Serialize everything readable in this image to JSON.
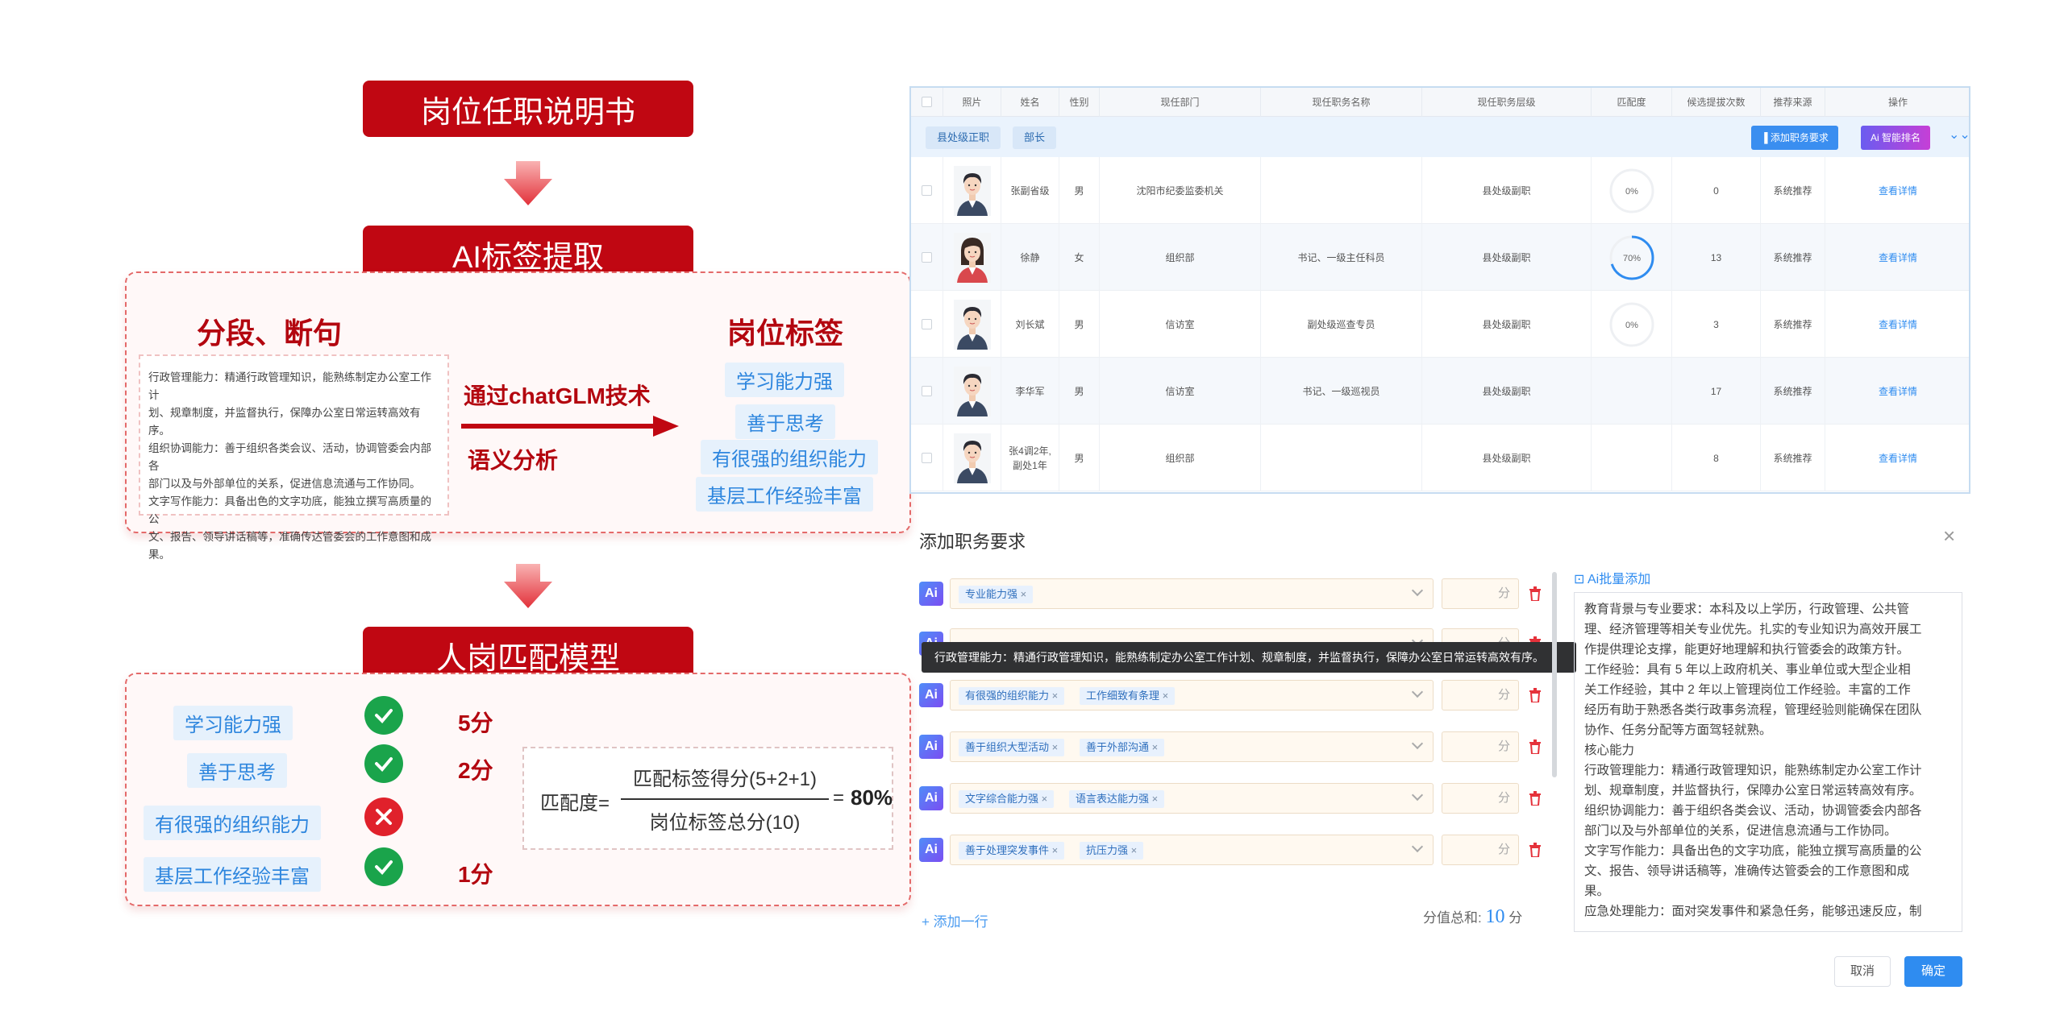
{
  "flow": {
    "title1": "岗位任职说明书",
    "title2": "AI标签提取",
    "title3": "人岗匹配模型",
    "segment_heading": "分段、断句",
    "tag_heading": "岗位标签",
    "via_label": "通过chatGLM技术",
    "semantic_label": "语义分析",
    "text_lines": [
      "行政管理能力：精通行政管理知识，能熟练制定办公室工作计",
      "划、规章制度，并监督执行，保障办公室日常运转高效有序。",
      "组织协调能力：善于组织各类会议、活动，协调管委会内部各",
      "部门以及与外部单位的关系，促进信息流通与工作协同。",
      "文字写作能力：具备出色的文字功底，能独立撰写高质量的公",
      "文、报告、领导讲话稿等，准确传达管委会的工作意图和成",
      "果。"
    ],
    "tags": [
      "学习能力强",
      "善于思考",
      "有很强的组织能力",
      "基层工作经验丰富"
    ],
    "match": [
      {
        "tag": "学习能力强",
        "ok": true,
        "score": "5分"
      },
      {
        "tag": "善于思考",
        "ok": true,
        "score": "2分"
      },
      {
        "tag": "有很强的组织能力",
        "ok": false,
        "score": ""
      },
      {
        "tag": "基层工作经验丰富",
        "ok": true,
        "score": "1分"
      }
    ],
    "formula": {
      "prefix": "匹配度=",
      "numerator": "匹配标签得分(5+2+1)",
      "denominator": "岗位标签总分(10)",
      "equals": "=",
      "result": "80%"
    }
  },
  "table": {
    "headers": [
      "",
      "照片",
      "姓名",
      "性别",
      "现任部门",
      "现任职务名称",
      "现任职务层级",
      "匹配度",
      "候选提拔次数",
      "推荐来源",
      "操作"
    ],
    "filters": [
      "县处级正职",
      "部长"
    ],
    "btn_add": "添加职务要求",
    "btn_ai": "智能排名",
    "ai_prefix": "Ai",
    "rows": [
      {
        "name": "张副省级",
        "gender": "男",
        "dept": "沈阳市纪委监委机关",
        "title": "",
        "level": "县处级副职",
        "match": "0%",
        "match_val": 0,
        "count": "0",
        "source": "系统推荐",
        "op": "查看详情",
        "female": false
      },
      {
        "name": "徐静",
        "gender": "女",
        "dept": "组织部",
        "title": "书记、一级主任科员",
        "level": "县处级副职",
        "match": "70%",
        "match_val": 70,
        "count": "13",
        "source": "系统推荐",
        "op": "查看详情",
        "female": true
      },
      {
        "name": "刘长斌",
        "gender": "男",
        "dept": "信访室",
        "title": "副处级巡查专员",
        "level": "县处级副职",
        "match": "0%",
        "match_val": 0,
        "count": "3",
        "source": "系统推荐",
        "op": "查看详情",
        "female": false
      },
      {
        "name": "李华军",
        "gender": "男",
        "dept": "信访室",
        "title": "书记、一级巡视员",
        "level": "县处级副职",
        "match": "",
        "match_val": null,
        "count": "17",
        "source": "系统推荐",
        "op": "查看详情",
        "female": false
      },
      {
        "name": "张4调2年,\n副处1年",
        "gender": "男",
        "dept": "组织部",
        "title": "",
        "level": "县处级副职",
        "match": "",
        "match_val": null,
        "count": "8",
        "source": "系统推荐",
        "op": "查看详情",
        "female": false
      }
    ]
  },
  "dialog": {
    "title": "添加职务要求",
    "close": "×",
    "ai_badge": "Ai",
    "score_unit": "分",
    "rows": [
      {
        "tags": [
          "专业能力强"
        ]
      },
      {
        "tags": []
      },
      {
        "tags": [
          "有很强的组织能力",
          "工作细致有条理"
        ]
      },
      {
        "tags": [
          "善于组织大型活动",
          "善于外部沟通"
        ]
      },
      {
        "tags": [
          "文字综合能力强",
          "语言表达能力强"
        ]
      },
      {
        "tags": [
          "善于处理突发事件",
          "抗压力强"
        ]
      }
    ],
    "tooltip": "行政管理能力：精通行政管理知识，能熟练制定办公室工作计划、规章制度，并监督执行，保障办公室日常运转高效有序。",
    "add_line": "+ 添加一行",
    "total_label": "分值总和:",
    "total_value": "10",
    "total_unit": "分",
    "ai_batch": "Ai批量添加",
    "description": [
      "教育背景与专业要求：本科及以上学历，行政管理、公共管",
      "理、经济管理等相关专业优先。扎实的专业知识为高效开展工",
      "作提供理论支撑，能更好地理解和执行管委会的政策方针。",
      "工作经验：具有 5 年以上政府机关、事业单位或大型企业相",
      "关工作经验，其中 2 年以上管理岗位工作经验。丰富的工作",
      "经历有助于熟悉各类行政事务流程，管理经验则能确保在团队",
      "协作、任务分配等方面驾轻就熟。",
      "核心能力",
      "行政管理能力：精通行政管理知识，能熟练制定办公室工作计",
      "划、规章制度，并监督执行，保障办公室日常运转高效有序。",
      "组织协调能力：善于组织各类会议、活动，协调管委会内部各",
      "部门以及与外部单位的关系，促进信息流通与工作协同。",
      "文字写作能力：具备出色的文字功底，能独立撰写高质量的公",
      "文、报告、领导讲话稿等，准确传达管委会的工作意图和成",
      "果。",
      "应急处理能力：面对突发事件和紧急任务，能够迅速反应，制"
    ],
    "cancel": "取消",
    "ok": "确定"
  },
  "colors": {
    "brand_red": "#c00712",
    "accent_blue": "#2f8cf0",
    "ok_green": "#1aa44b",
    "no_red": "#e0212b"
  }
}
